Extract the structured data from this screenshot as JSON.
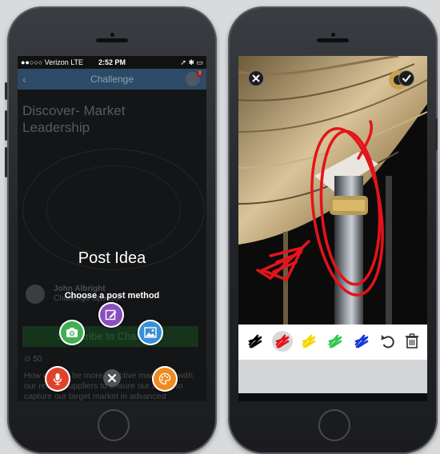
{
  "left_phone": {
    "status": {
      "carrier": "●●○○○ Verizon  LTE",
      "time": "2:52 PM",
      "indicators": "➚ ✱ ▭"
    },
    "navbar": {
      "back": "‹",
      "title": "Challenge",
      "badge": "3"
    },
    "challenge_title": "Discover- Market Leadership",
    "author": {
      "name": "John Albright",
      "role": "Challenge Sponsor"
    },
    "subscribe_label": "Subscribe to Challenge",
    "stats": "⊙ 50",
    "body_text": "How can we be more effective marketing with our recent suppliers to ensure our ability to capture our target market in advanced workflows?",
    "overlay": {
      "title": "Post Idea",
      "subtitle": "Choose a post method"
    },
    "post_methods": [
      {
        "name": "camera",
        "color": "#3fae55"
      },
      {
        "name": "edit",
        "color": "#8a4fbf"
      },
      {
        "name": "gallery",
        "color": "#3a8fd6"
      },
      {
        "name": "microphone",
        "color": "#e0412c"
      },
      {
        "name": "close",
        "color": "#505459"
      },
      {
        "name": "draw",
        "color": "#ef8a21"
      }
    ]
  },
  "right_phone": {
    "brush_colors": [
      {
        "name": "black",
        "color": "#000000"
      },
      {
        "name": "red",
        "color": "#e3141a"
      },
      {
        "name": "yellow",
        "color": "#f5d700"
      },
      {
        "name": "green",
        "color": "#2fc94a"
      },
      {
        "name": "blue",
        "color": "#1537d8"
      }
    ],
    "selected_color": "red",
    "annotation_color": "#e3141a"
  }
}
